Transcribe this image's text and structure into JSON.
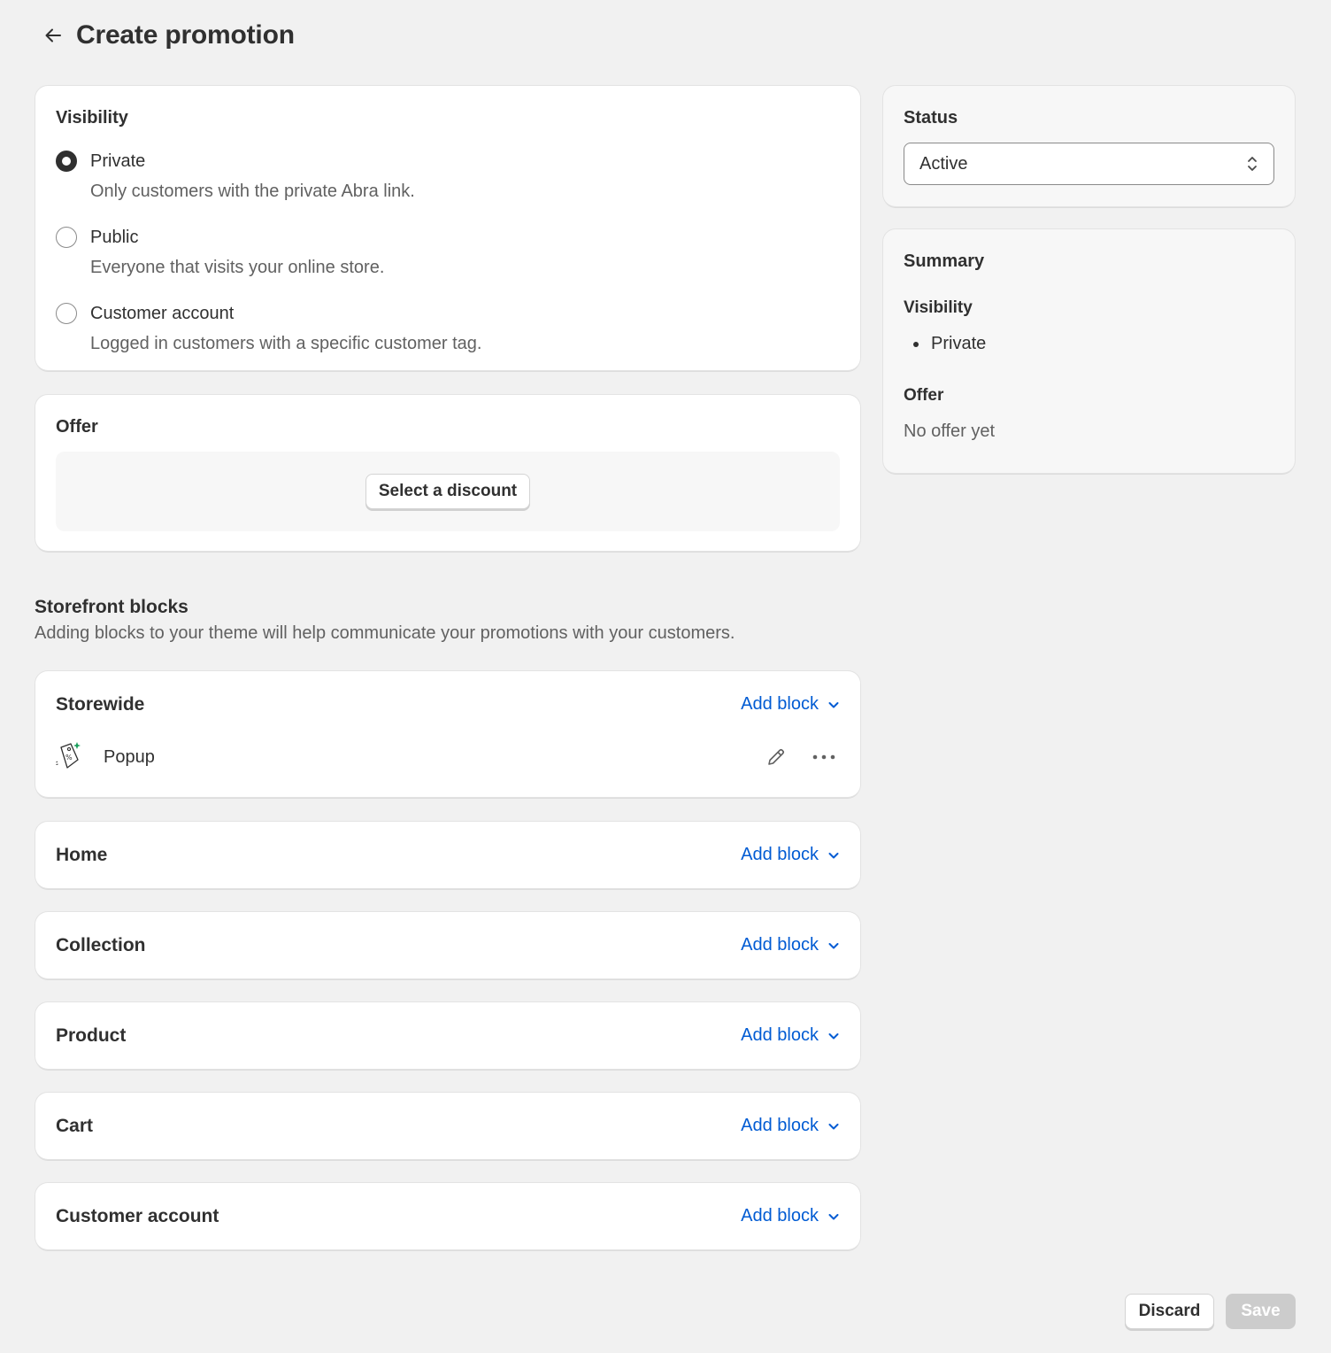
{
  "header": {
    "title": "Create promotion"
  },
  "visibility": {
    "title": "Visibility",
    "options": [
      {
        "label": "Private",
        "help": "Only customers with the private Abra link.",
        "checked": true
      },
      {
        "label": "Public",
        "help": "Everyone that visits your online store.",
        "checked": false
      },
      {
        "label": "Customer account",
        "help": "Logged in customers with a specific customer tag.",
        "checked": false
      }
    ]
  },
  "offer": {
    "title": "Offer",
    "button_label": "Select a discount"
  },
  "storefront": {
    "title": "Storefront blocks",
    "subtitle": "Adding blocks to your theme will help communicate your promotions with your customers.",
    "add_block_label": "Add block",
    "sections": [
      "Storewide",
      "Home",
      "Collection",
      "Product",
      "Cart",
      "Customer account"
    ],
    "storewide_items": [
      {
        "label": "Popup",
        "icon": "popup-tag-icon"
      }
    ]
  },
  "status": {
    "title": "Status",
    "selected": "Active"
  },
  "summary": {
    "title": "Summary",
    "visibility_title": "Visibility",
    "visibility_value": "Private",
    "offer_title": "Offer",
    "offer_value": "No offer yet"
  },
  "footer": {
    "discard_label": "Discard",
    "save_label": "Save"
  },
  "colors": {
    "accent_link": "#005bd3",
    "background": "#f1f1f1",
    "save_disabled": "#cccccc"
  }
}
